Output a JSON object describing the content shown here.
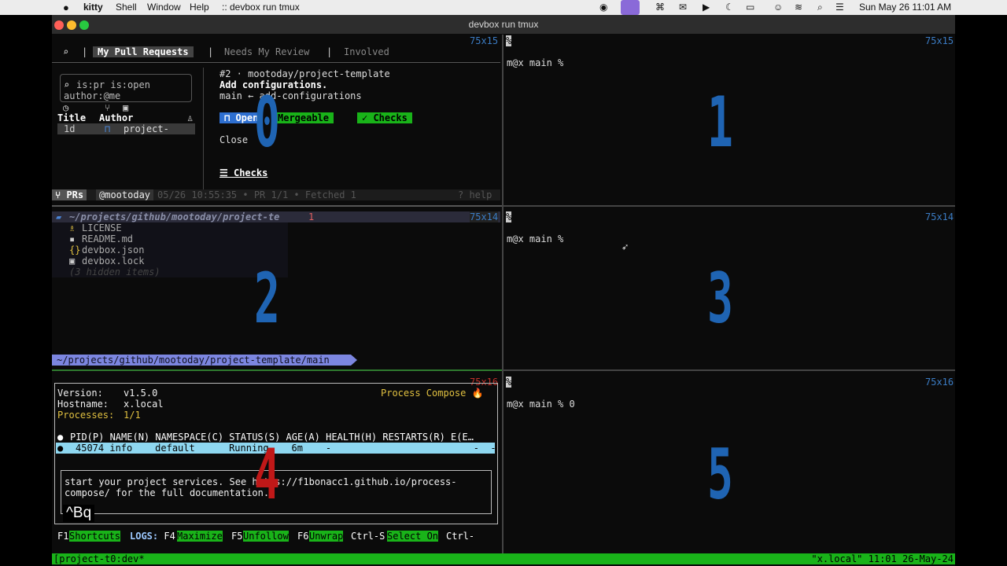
{
  "menubar": {
    "apple": "",
    "app": "kitty",
    "items": [
      "Shell",
      "Window",
      "Help",
      ":: devbox run tmux"
    ],
    "clock": "Sun May 26  11:01 AM"
  },
  "window": {
    "title": "devbox run tmux"
  },
  "pane0": {
    "size": "75x15",
    "tabs": [
      "My Pull Requests",
      "Needs My Review",
      "Involved"
    ],
    "sep": "|",
    "search_line1": "is:pr is:open",
    "search_line2": "author:@me",
    "col_title": "Title",
    "col_author": "Author",
    "row_age": "1d",
    "row_repo": "project-",
    "pr_header": "#2 · mootoday/project-template",
    "pr_title": "Add configurations.",
    "pr_branch": "main ← add-configurations",
    "badge_open": "Open",
    "badge_mergeable": "Mergeable",
    "badge_checks": "✓ Checks",
    "close_label": "Close",
    "checks_link": "Checks",
    "status_prs": "PRs",
    "status_user": "@mootoday",
    "status_time": "05/26 10:55:35 • PR 1/1 • Fetched 1",
    "status_help": "? help",
    "pane_number": "0"
  },
  "pane1": {
    "size": "75x15",
    "prompt": "m@x main %",
    "pane_number": "1"
  },
  "pane2": {
    "size": "75x14",
    "path": "~/projects/github/mootoday/project-te",
    "count": "1",
    "files": [
      {
        "icon": "license-icon",
        "name": "LICENSE"
      },
      {
        "icon": "markdown-icon",
        "name": "README.md"
      },
      {
        "icon": "json-icon",
        "name": "devbox.json"
      },
      {
        "icon": "lock-icon",
        "name": "devbox.lock"
      }
    ],
    "hidden": "(3 hidden items)",
    "footer_path": "~/projects/github/mootoday/project-template/main",
    "pane_number": "2"
  },
  "pane3": {
    "size": "75x14",
    "prompt": "m@x main %",
    "pane_number": "3"
  },
  "pane4": {
    "size": "75x16",
    "version_label": "Version:",
    "version": "v1.5.0",
    "hostname_label": "Hostname:",
    "hostname": "x.local",
    "processes_label": "Processes:",
    "processes": "1/1",
    "brand": "Process Compose 🔥",
    "columns": "PID(P) NAME(N) NAMESPACE(C) STATUS(S) AGE(A) HEALTH(H) RESTARTS(R) E(E…",
    "row": "45074 info    default      Running    6m    -                         -  -",
    "log_line1": "start your project services. See https://f1bonacc1.github.io/process-",
    "log_line2": "compose/ for the full documentation.",
    "log_title": "^Bq",
    "shortcuts": [
      {
        "key": "F1",
        "label": "Shortcuts"
      },
      {
        "key": "LOGS: F4",
        "label": "Maximize"
      },
      {
        "key": "F5",
        "label": "Unfollow"
      },
      {
        "key": "F6",
        "label": "Unwrap"
      },
      {
        "key": "Ctrl-S",
        "label": "Select On"
      }
    ],
    "trailing": "Ctrl-",
    "pane_number": "4"
  },
  "pane5": {
    "size": "75x16",
    "prompt": "m@x main % 0",
    "pane_number": "5"
  },
  "tmux": {
    "left": "[project-t0:dev*",
    "right": "\"x.local\" 11:01 26-May-24"
  },
  "colors": {
    "accent_blue": "#1f64b3",
    "tmux_green": "#19b319",
    "pane_label_blue": "#3b7cc4"
  }
}
